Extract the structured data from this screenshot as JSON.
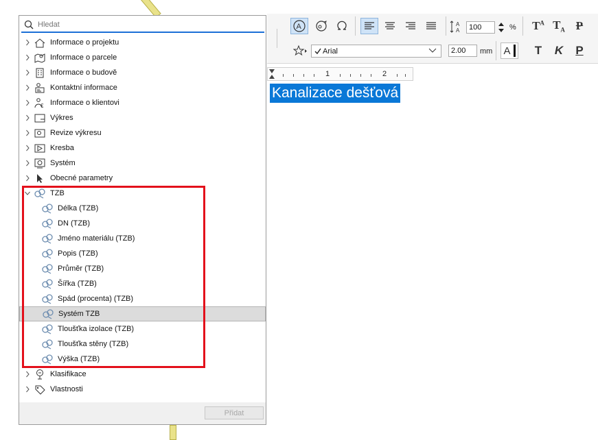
{
  "search": {
    "placeholder": "Hledat"
  },
  "tree": [
    {
      "label": "Informace o projektu",
      "icon": "house-icon",
      "expanded": false
    },
    {
      "label": "Informace o parcele",
      "icon": "map-pin-icon",
      "expanded": false
    },
    {
      "label": "Informace o budově",
      "icon": "building-icon",
      "expanded": false
    },
    {
      "label": "Kontaktní informace",
      "icon": "contact-icon",
      "expanded": false
    },
    {
      "label": "Informace o klientovi",
      "icon": "client-euro-icon",
      "expanded": false
    },
    {
      "label": "Výkres",
      "icon": "drawing-sheet-icon",
      "expanded": false
    },
    {
      "label": "Revize výkresu",
      "icon": "revision-icon",
      "expanded": false
    },
    {
      "label": "Kresba",
      "icon": "sketch-icon",
      "expanded": false
    },
    {
      "label": "Systém",
      "icon": "system-gear-icon",
      "expanded": false
    },
    {
      "label": "Obecné parametry",
      "icon": "cursor-arrow-icon",
      "expanded": false
    },
    {
      "label": "TZB",
      "icon": "mep-icon",
      "expanded": true,
      "children": [
        {
          "label": "Délka (TZB)"
        },
        {
          "label": "DN (TZB)"
        },
        {
          "label": "Jméno materiálu (TZB)"
        },
        {
          "label": "Popis (TZB)"
        },
        {
          "label": "Průměr (TZB)"
        },
        {
          "label": "Šířka (TZB)"
        },
        {
          "label": "Spád (procenta) (TZB)"
        },
        {
          "label": "Systém TZB",
          "selected": true
        },
        {
          "label": "Tloušťka izolace (TZB)"
        },
        {
          "label": "Tloušťka stěny (TZB)"
        },
        {
          "label": "Výška (TZB)"
        }
      ]
    },
    {
      "label": "Klasifikace",
      "icon": "classification-tree-icon",
      "expanded": false
    },
    {
      "label": "Vlastnosti",
      "icon": "properties-tag-icon",
      "expanded": false
    }
  ],
  "footer": {
    "add_label": "Přidat"
  },
  "toolbar": {
    "line_spacing_value": "100",
    "line_spacing_unit": "%",
    "font_name": "Arial",
    "font_size_value": "2.00",
    "font_size_unit": "mm"
  },
  "ruler": {
    "marks": [
      "1",
      "2"
    ]
  },
  "canvas": {
    "selected_text": "Kanalizace dešťová"
  },
  "colors": {
    "accent": "#1a6fd6",
    "selection": "#0a78d7",
    "highlight_box": "#e3101b"
  }
}
